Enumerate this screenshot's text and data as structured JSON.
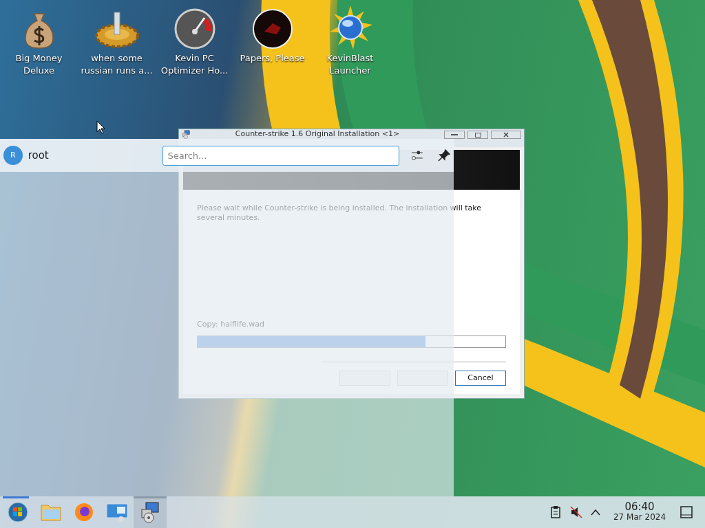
{
  "desktop_icons": [
    {
      "kind": "money-bag",
      "lines": [
        "Big Money",
        "Deluxe"
      ]
    },
    {
      "kind": "gear",
      "lines": [
        "when some",
        "russian runs a..."
      ]
    },
    {
      "kind": "gauge",
      "lines": [
        "Kevin PC",
        "Optimizer Ho..."
      ]
    },
    {
      "kind": "dark-disc",
      "lines": [
        "Papers, Please"
      ]
    },
    {
      "kind": "sun-globe",
      "lines": [
        "KevinBlast",
        "Launcher"
      ]
    }
  ],
  "dialog": {
    "title": "Counter-strike 1.6 Original Installation <1>",
    "message": "Please wait while Counter-strike is being installed. The installation will take several minutes.",
    "status": "Copy: halflife.wad",
    "progress": {
      "level": 0.74
    },
    "buttons": [
      {
        "disabled": true
      },
      {
        "disabled": true
      },
      {
        "label": "Cancel",
        "disabled": false
      }
    ]
  },
  "launcher": {
    "open": true,
    "user": {
      "initial": "R",
      "name": "root"
    },
    "search": {
      "placeholder": "Search..."
    }
  },
  "taskbar": {
    "items": [
      {
        "kind": "start",
        "selected": false
      },
      {
        "kind": "folder",
        "selected": false
      },
      {
        "kind": "browser",
        "selected": false
      },
      {
        "kind": "remote",
        "selected": false
      },
      {
        "kind": "installer",
        "selected": true
      }
    ],
    "time": "06:40",
    "date": "27 Mar 2024"
  }
}
